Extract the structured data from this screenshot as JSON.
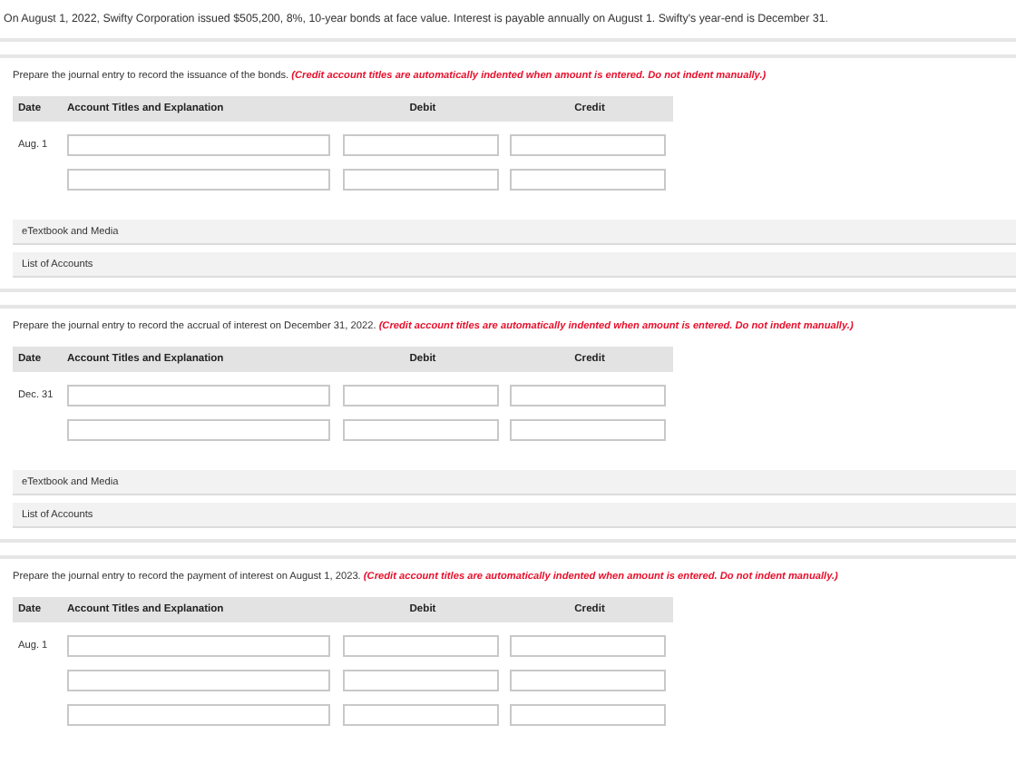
{
  "intro": "On August 1, 2022, Swifty Corporation issued $505,200, 8%, 10-year bonds at face value. Interest is payable annually on August 1. Swifty's year-end is December 31.",
  "parts": [
    {
      "instruction": "Prepare the journal entry to record the issuance of the bonds.",
      "note": "(Credit account titles are automatically indented when amount is entered. Do not indent manually.)",
      "columns": [
        "Date",
        "Account Titles and Explanation",
        "Debit",
        "Credit"
      ],
      "date": "Aug. 1",
      "rows": [
        {
          "kind": "entry"
        },
        {
          "kind": "entry"
        }
      ],
      "links": [
        "eTextbook and Media",
        "List of Accounts"
      ]
    },
    {
      "instruction": "Prepare the journal entry to record the accrual of interest on December 31, 2022.",
      "note": "(Credit account titles are automatically indented when amount is entered. Do not indent manually.)",
      "columns": [
        "Date",
        "Account Titles and Explanation",
        "Debit",
        "Credit"
      ],
      "date": "Dec. 31",
      "rows": [
        {
          "kind": "entry"
        },
        {
          "kind": "entry"
        }
      ],
      "links": [
        "eTextbook and Media",
        "List of Accounts"
      ]
    },
    {
      "instruction": "Prepare the journal entry to record the payment of interest on August 1, 2023.",
      "note": "(Credit account titles are automatically indented when amount is entered. Do not indent manually.)",
      "columns": [
        "Date",
        "Account Titles and Explanation",
        "Debit",
        "Credit"
      ],
      "date": "Aug. 1",
      "rows": [
        {
          "kind": "entry"
        },
        {
          "kind": "entry"
        },
        {
          "kind": "entry"
        }
      ]
    }
  ]
}
